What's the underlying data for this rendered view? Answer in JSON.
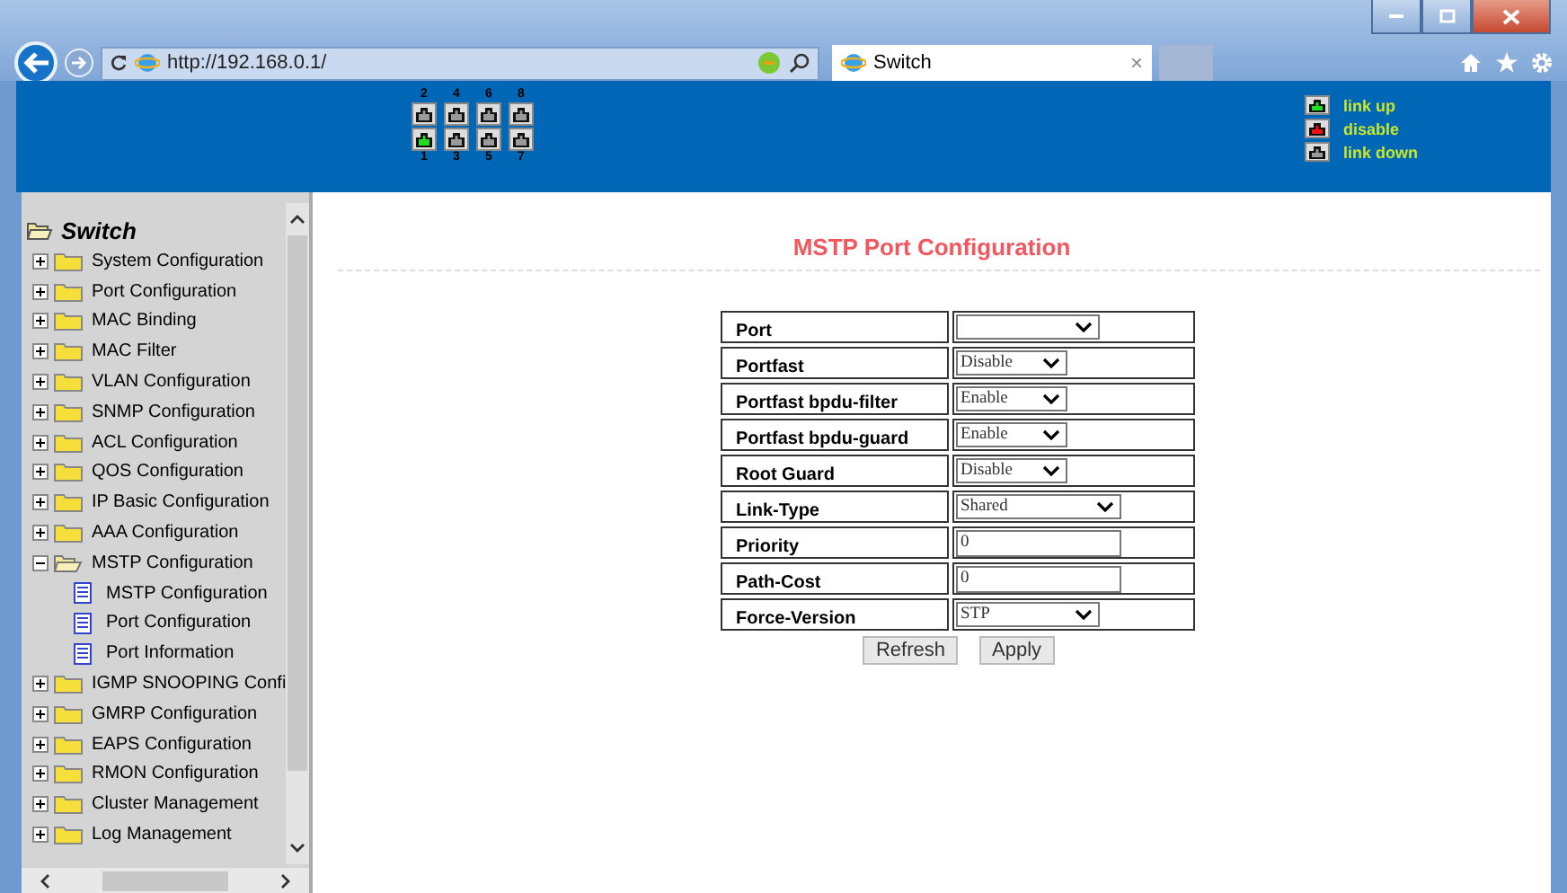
{
  "browser": {
    "address": "http://192.168.0.1/",
    "tab": {
      "title": "Switch",
      "close": "×"
    }
  },
  "ports": {
    "top": [
      {
        "number": "2",
        "color": "#9a9a9a"
      },
      {
        "number": "4",
        "color": "#9a9a9a"
      },
      {
        "number": "6",
        "color": "#9a9a9a"
      },
      {
        "number": "8",
        "color": "#9a9a9a"
      }
    ],
    "bottom": [
      {
        "number": "1",
        "color": "#22dd22"
      },
      {
        "number": "3",
        "color": "#9a9a9a"
      },
      {
        "number": "5",
        "color": "#9a9a9a"
      },
      {
        "number": "7",
        "color": "#9a9a9a"
      }
    ]
  },
  "legend": [
    {
      "label": "link up",
      "color": "#22dd22"
    },
    {
      "label": "disable",
      "color": "#ee1111"
    },
    {
      "label": "link down",
      "color": "#9a9a9a"
    }
  ],
  "sidebar": {
    "root": "Switch",
    "items": [
      {
        "label": "System Configuration",
        "expanded": false
      },
      {
        "label": "Port Configuration",
        "expanded": false
      },
      {
        "label": "MAC Binding",
        "expanded": false
      },
      {
        "label": "MAC Filter",
        "expanded": false
      },
      {
        "label": "VLAN Configuration",
        "expanded": false
      },
      {
        "label": "SNMP Configuration",
        "expanded": false
      },
      {
        "label": "ACL Configuration",
        "expanded": false
      },
      {
        "label": "QOS Configuration",
        "expanded": false
      },
      {
        "label": "IP Basic Configuration",
        "expanded": false
      },
      {
        "label": "AAA Configuration",
        "expanded": false
      },
      {
        "label": "MSTP Configuration",
        "expanded": true,
        "children": [
          {
            "label": "MSTP Configuration"
          },
          {
            "label": "Port Configuration"
          },
          {
            "label": "Port Information"
          }
        ]
      },
      {
        "label": "IGMP SNOOPING Confi",
        "expanded": false
      },
      {
        "label": "GMRP Configuration",
        "expanded": false
      },
      {
        "label": "EAPS Configuration",
        "expanded": false
      },
      {
        "label": "RMON Configuration",
        "expanded": false
      },
      {
        "label": "Cluster Management",
        "expanded": false
      },
      {
        "label": "Log Management",
        "expanded": false
      }
    ]
  },
  "form": {
    "title": "MSTP Port Configuration",
    "rows": [
      {
        "label": "Port",
        "kind": "select",
        "value": ""
      },
      {
        "label": "Portfast",
        "kind": "select",
        "value": "Disable"
      },
      {
        "label": "Portfast bpdu-filter",
        "kind": "select",
        "value": "Enable"
      },
      {
        "label": "Portfast bpdu-guard",
        "kind": "select",
        "value": "Enable"
      },
      {
        "label": "Root Guard",
        "kind": "select",
        "value": "Disable"
      },
      {
        "label": "Link-Type",
        "kind": "select",
        "value": "Shared"
      },
      {
        "label": "Priority",
        "kind": "input",
        "value": "0"
      },
      {
        "label": "Path-Cost",
        "kind": "input",
        "value": "0"
      },
      {
        "label": "Force-Version",
        "kind": "select",
        "value": "STP"
      }
    ],
    "buttons": [
      "Refresh",
      "Apply"
    ]
  }
}
